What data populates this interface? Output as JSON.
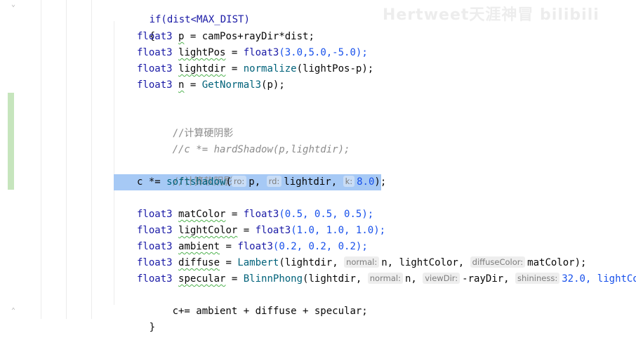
{
  "watermark": "Hertweet天涯神冒 bilibili",
  "code": {
    "line_0": "if(dist<MAX_DIST)",
    "line_1": "{",
    "line_2": {
      "type": "float3",
      "name": "p",
      "rest": " = camPos+rayDir*dist;"
    },
    "line_3": {
      "type": "float3",
      "name": "lightPos",
      "eq": " = ",
      "fn": "float3",
      "args": "(3.0,5.0,-5.0);"
    },
    "line_4": {
      "type": "float3",
      "name": "lightdir",
      "eq": " = ",
      "fn": "normalize",
      "args": "(lightPos-p);"
    },
    "line_5": {
      "type": "float3",
      "name": "n",
      "eq": " = ",
      "fn": "GetNormal3",
      "args": "(p);"
    },
    "line_7": "//计算硬阴影",
    "line_8": "//c *= hardShadow(p,lightdir);",
    "line_10": "//计算软阴影",
    "line_11": {
      "pre": "c *= ",
      "fn": "softshadow",
      "open": "(",
      "hint_ro": "ro:",
      "arg_ro": "p,",
      "hint_rd": "rd:",
      "arg_rd": "lightdir,",
      "hint_k": "k:",
      "arg_k": "8.0",
      "close": ");"
    },
    "line_13": {
      "type": "float3",
      "name": "matColor",
      "eq": " = ",
      "fn": "float3",
      "args": "(0.5, 0.5, 0.5);"
    },
    "line_14": {
      "type": "float3",
      "name": "lightColor",
      "eq": " = ",
      "fn": "float3",
      "args": "(1.0, 1.0, 1.0);"
    },
    "line_15": {
      "type": "float3",
      "name": "ambient",
      "eq": " = ",
      "fn": "float3",
      "args": "(0.2, 0.2, 0.2);"
    },
    "line_16": {
      "type": "float3",
      "name": "diffuse",
      "eq": " = ",
      "fn": "Lambert",
      "a1": "(lightdir, ",
      "hint_normal": "normal:",
      "a2": "n, lightColor, ",
      "hint_diffuse": "diffuseColor:",
      "a3": "matColor);"
    },
    "line_17": {
      "type": "float3",
      "name": "specular",
      "eq": " = ",
      "fn": "BlinnPhong",
      "a1": "(lightdir, ",
      "hint_normal": "normal:",
      "a2": "n, ",
      "hint_view": "viewDir:",
      "a3": "-rayDir, ",
      "hint_shin": "shininess:",
      "a4": "32.0, lightCol"
    },
    "line_18": "c+= ambient + diffuse + specular;",
    "line_19": "}"
  },
  "colors": {
    "selection": "#a6c9f5",
    "change_marker": "#c6e5bd",
    "keyword": "#1a1aa6",
    "function": "#00627a",
    "number": "#1750eb",
    "comment": "#8c8c8c"
  }
}
